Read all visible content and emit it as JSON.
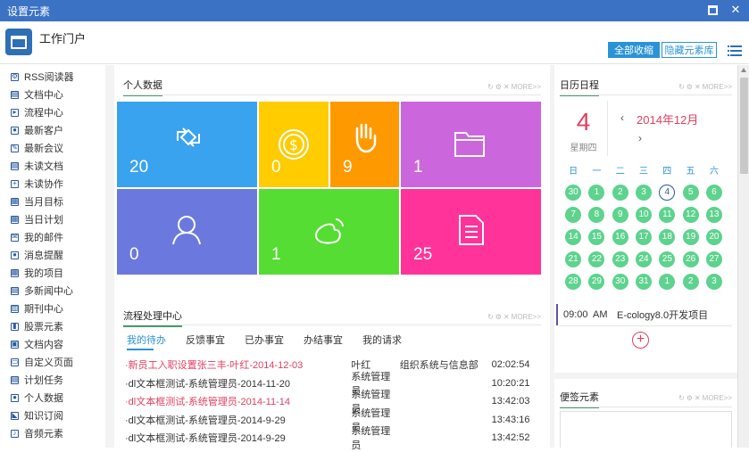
{
  "window": {
    "title": "设置元素"
  },
  "header": {
    "app_title": "工作门户",
    "collapse_all": "全部收缩",
    "hide_library": "隐藏元素库"
  },
  "sidebar": {
    "items": [
      {
        "label": "RSS阅读器",
        "icon": "gear-icon"
      },
      {
        "label": "文档中心",
        "icon": "document-icon"
      },
      {
        "label": "流程中心",
        "icon": "flow-icon"
      },
      {
        "label": "最新客户",
        "icon": "user-icon"
      },
      {
        "label": "最新会议",
        "icon": "pen-icon"
      },
      {
        "label": "未读文档",
        "icon": "document-icon"
      },
      {
        "label": "未读协作",
        "icon": "plus-circle-icon"
      },
      {
        "label": "当月目标",
        "icon": "calendar-icon"
      },
      {
        "label": "当日计划",
        "icon": "calendar-icon"
      },
      {
        "label": "我的邮件",
        "icon": "mail-icon"
      },
      {
        "label": "消息提醒",
        "icon": "chat-icon"
      },
      {
        "label": "我的项目",
        "icon": "grid-icon"
      },
      {
        "label": "多新闻中心",
        "icon": "news-icon"
      },
      {
        "label": "期刊中心",
        "icon": "book-icon"
      },
      {
        "label": "股票元素",
        "icon": "chart-icon"
      },
      {
        "label": "文档内容",
        "icon": "lock-icon"
      },
      {
        "label": "自定义页面",
        "icon": "page-icon"
      },
      {
        "label": "计划任务",
        "icon": "task-icon"
      },
      {
        "label": "个人数据",
        "icon": "user-icon"
      },
      {
        "label": "知识订阅",
        "icon": "rss-icon"
      },
      {
        "label": "音频元素",
        "icon": "music-icon"
      }
    ]
  },
  "personal": {
    "title": "个人数据",
    "tiles": [
      {
        "value": "20",
        "icon": "refresh-arrows-icon",
        "color": "#3aa3f0"
      },
      {
        "value": "0",
        "icon": "coin-icon",
        "color": "#ffcc00"
      },
      {
        "value": "9",
        "icon": "hand-icon",
        "color": "#ff9900"
      },
      {
        "value": "1",
        "icon": "folder-icon",
        "color": "#cc66dd"
      },
      {
        "value": "0",
        "icon": "person-icon",
        "color": "#6b79df"
      },
      {
        "value": "1",
        "icon": "weibo-icon",
        "color": "#55dd33"
      },
      {
        "value": "25",
        "icon": "file-icon",
        "color": "#ff3399"
      }
    ],
    "tools": "MORE>>"
  },
  "workflow": {
    "title": "流程处理中心",
    "tabs": [
      "我的待办",
      "反馈事宜",
      "已办事宜",
      "办结事宜",
      "我的请求"
    ],
    "rows": [
      {
        "title": "·新员工入职设置张三丰-叶红-2014-12-03",
        "user": "叶红",
        "dept": "组织系统与信息部",
        "time": "02:02:54",
        "highlight": true
      },
      {
        "title": "·dl文本框测试-系统管理员-2014-11-20",
        "user": "系统管理员",
        "dept": "",
        "time": "10:20:21",
        "highlight": false
      },
      {
        "title": "·dl文本框测试-系统管理员-2014-11-14",
        "user": "系统管理员",
        "dept": "",
        "time": "13:42:03",
        "highlight": true
      },
      {
        "title": "·dl文本框测试-系统管理员-2014-9-29",
        "user": "系统管理员",
        "dept": "",
        "time": "13:43:16",
        "highlight": false
      },
      {
        "title": "·dl文本框测试-系统管理员-2014-9-29",
        "user": "系统管理员",
        "dept": "",
        "time": "13:42:52",
        "highlight": false
      }
    ]
  },
  "calendar": {
    "title": "日历日程",
    "day": "4",
    "weekday": "星期四",
    "month": "2014年12月",
    "weekdays": [
      "日",
      "一",
      "二",
      "三",
      "四",
      "五",
      "六"
    ],
    "days": [
      "30",
      "1",
      "2",
      "3",
      "4",
      "5",
      "6",
      "7",
      "8",
      "9",
      "10",
      "11",
      "12",
      "13",
      "14",
      "15",
      "16",
      "17",
      "18",
      "19",
      "20",
      "21",
      "22",
      "23",
      "24",
      "25",
      "26",
      "27",
      "28",
      "29",
      "30",
      "31",
      "1",
      "2",
      "3"
    ],
    "today_index": 4,
    "event_time": "09:00  AM",
    "event_title": "E-cology8.0开发项目"
  },
  "notes": {
    "title": "便签元素"
  }
}
